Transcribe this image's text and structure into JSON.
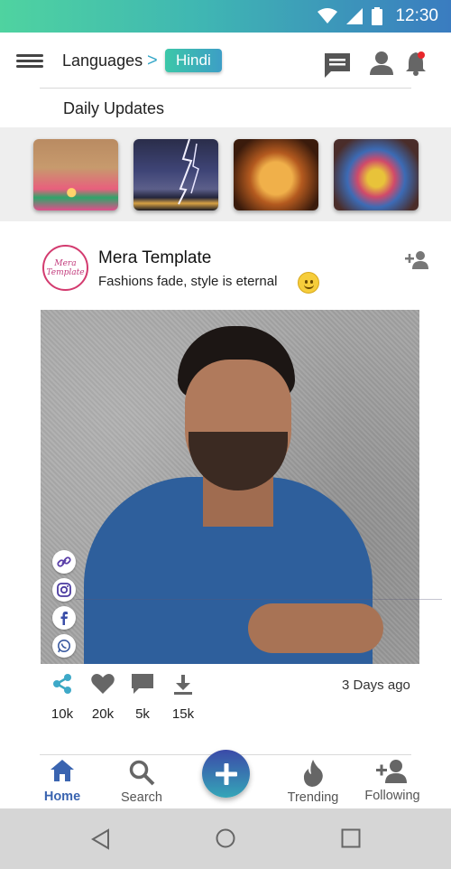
{
  "status_bar": {
    "time": "12:30"
  },
  "header": {
    "breadcrumb_root": "Languages",
    "breadcrumb_separator": ">",
    "breadcrumb_current": "Hindi",
    "icons": [
      "menu-icon",
      "chat-icon",
      "profile-icon",
      "notification-bell-icon"
    ]
  },
  "daily_updates": {
    "title": "Daily Updates"
  },
  "stories": [
    {
      "name": "diya-lamp-story"
    },
    {
      "name": "lightning-story"
    },
    {
      "name": "ganesha-story"
    },
    {
      "name": "holi-colors-story"
    }
  ],
  "post": {
    "avatar_text": "Mera Template",
    "name": "Mera Template",
    "bio": "Fashions fade, style is eternal",
    "time_ago": "3 Days ago",
    "share_icons": [
      "link-icon",
      "instagram-icon",
      "facebook-icon",
      "whatsapp-icon"
    ],
    "stats": {
      "shares": "10k",
      "likes": "20k",
      "comments": "5k",
      "downloads": "15k"
    }
  },
  "bottom_nav": {
    "items": [
      {
        "label": "Home",
        "icon": "home-icon",
        "active": true
      },
      {
        "label": "Search",
        "icon": "search-icon",
        "active": false
      },
      {
        "label": "Trending",
        "icon": "flame-icon",
        "active": false
      },
      {
        "label": "Following",
        "icon": "add-person-icon",
        "active": false
      }
    ],
    "fab_icon": "plus-icon"
  },
  "colors": {
    "accent_teal": "#3cc7a8",
    "accent_blue": "#3a64b0",
    "notification_dot": "#e8262b"
  }
}
